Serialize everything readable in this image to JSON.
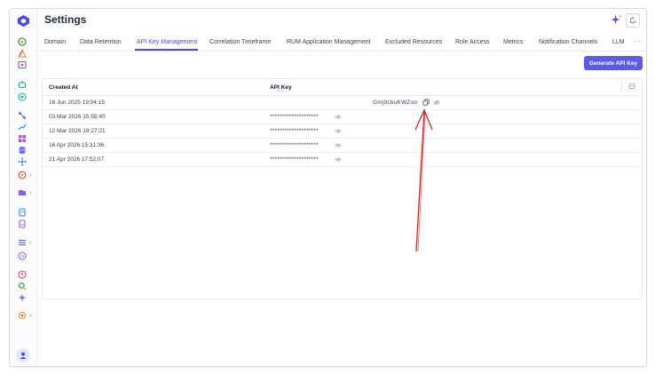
{
  "app": {
    "title": "Settings"
  },
  "icons": {
    "logo": "app-logo-icon",
    "sparkle": "sparkle-icon",
    "refresh": "refresh-icon",
    "more": "more-horizontal-icon"
  },
  "tabs": [
    {
      "label": "Domain",
      "active": false
    },
    {
      "label": "Data Retention",
      "active": false
    },
    {
      "label": "API Key Management",
      "active": true
    },
    {
      "label": "Correlation Timeframe",
      "active": false
    },
    {
      "label": "RUM Application Management",
      "active": false
    },
    {
      "label": "Excluded Resources",
      "active": false
    },
    {
      "label": "Role Access",
      "active": false
    },
    {
      "label": "Metrics",
      "active": false
    },
    {
      "label": "Notification Channels",
      "active": false
    },
    {
      "label": "LLM",
      "active": false
    }
  ],
  "more_label": "···",
  "actions": {
    "generate_label": "Generate API Key"
  },
  "table": {
    "headers": [
      "Created At",
      "API Key"
    ],
    "rows": [
      {
        "created": "16 Jun 2025 19:04:15",
        "key": "Gmj9cbuKWZoo",
        "revealed": true
      },
      {
        "created": "03 Mar 2026 15:55:45",
        "key": "********************",
        "revealed": false
      },
      {
        "created": "12 Mar 2026 18:27:21",
        "key": "********************",
        "revealed": false
      },
      {
        "created": "16 Apr 2026 15:31:36",
        "key": "********************",
        "revealed": false
      },
      {
        "created": "21 Apr 2026 17:52:07",
        "key": "********************",
        "revealed": false
      }
    ]
  },
  "colors": {
    "accent": "#5b5be6",
    "annotation": "#e02020"
  }
}
